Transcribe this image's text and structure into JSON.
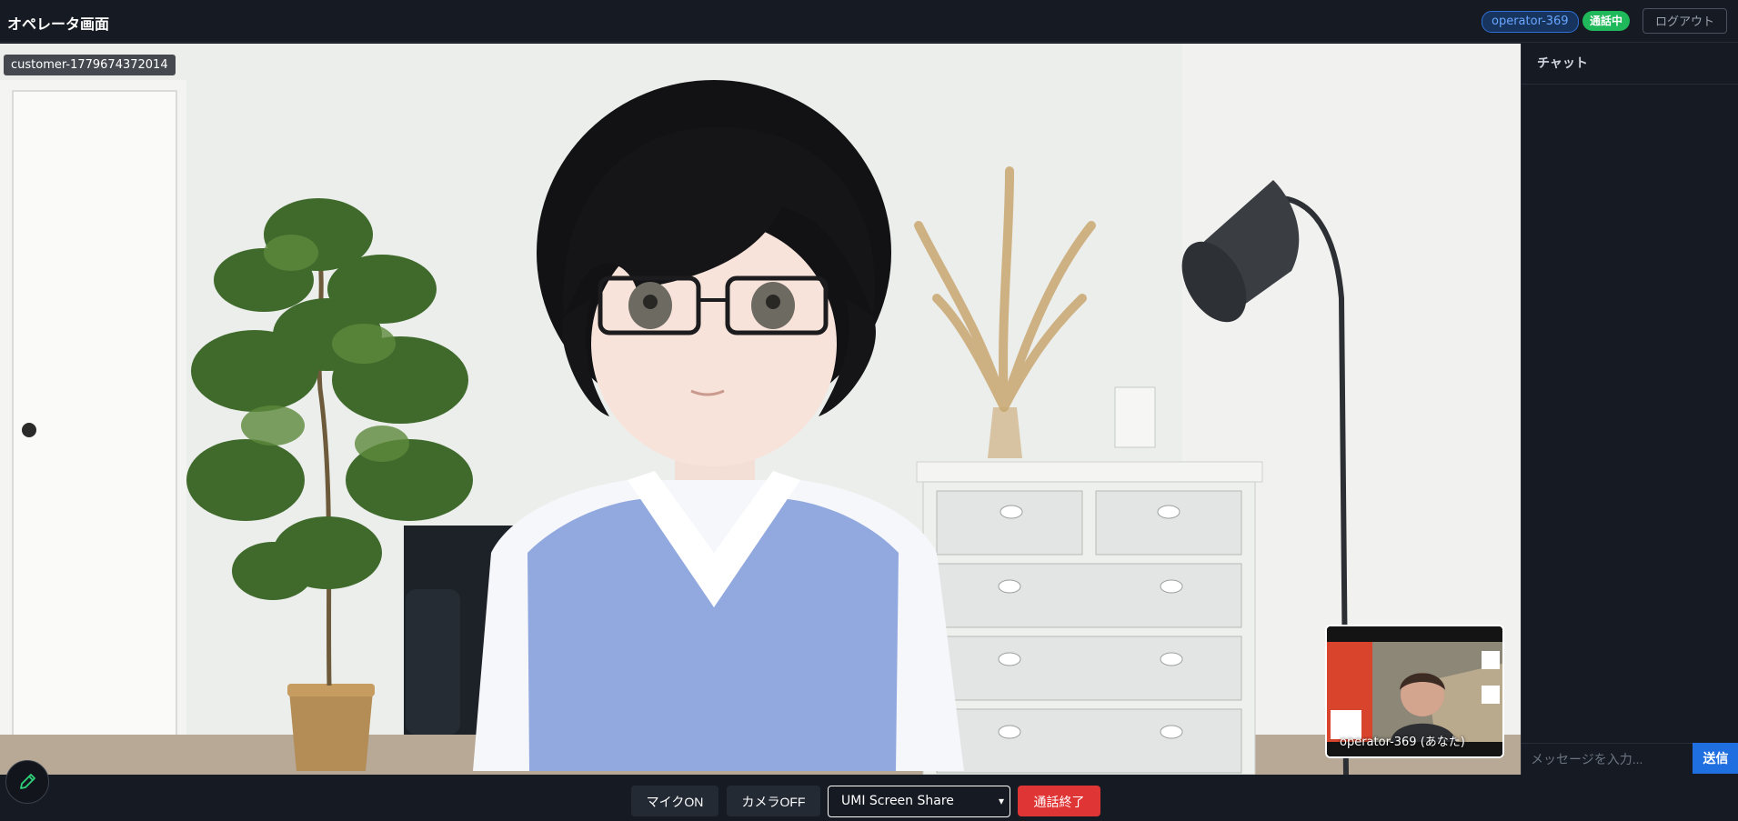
{
  "header": {
    "title": "オペレータ画面",
    "operator_badge": "operator-369",
    "status_badge": "通話中",
    "logout_label": "ログアウト"
  },
  "remote_video": {
    "label": "customer-1779674372014"
  },
  "self_video": {
    "label": "operator-369 (あなた)"
  },
  "chat": {
    "title": "チャット",
    "input_placeholder": "メッセージを入力...",
    "send_label": "送信"
  },
  "controls": {
    "mic_label": "マイクON",
    "camera_label": "カメラOFF",
    "share_selected": "UMI Screen Share",
    "end_label": "通話終了"
  },
  "colors": {
    "background": "#161b23",
    "accent_blue": "#1f6fe0",
    "status_green": "#1fb85a",
    "end_red": "#e03535"
  },
  "icons": [
    "pencil-icon",
    "chevron-down-icon"
  ]
}
